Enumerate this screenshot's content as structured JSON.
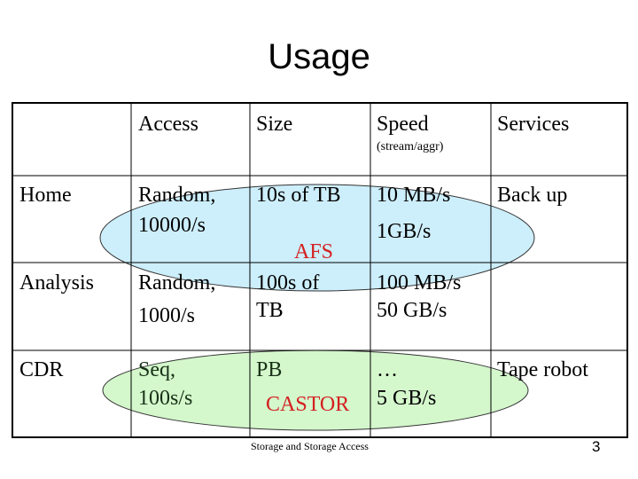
{
  "title": "Usage",
  "table": {
    "headers": [
      "",
      "Access",
      "Size",
      "Speed",
      "Services"
    ],
    "speed_subheader": "(stream/aggr)",
    "rows": [
      {
        "name": "Home",
        "access": [
          "Random,",
          "10000/s"
        ],
        "size": [
          "10s of TB"
        ],
        "speed": [
          "10 MB/s",
          "1GB/s"
        ],
        "services": "Back up"
      },
      {
        "name": "Analysis",
        "access": [
          "Random,",
          "1000/s"
        ],
        "size": [
          "100s of",
          "TB"
        ],
        "speed": [
          "100 MB/s",
          "50 GB/s"
        ],
        "services": ""
      },
      {
        "name": "CDR",
        "access": [
          "Seq,",
          "100s/s"
        ],
        "size": [
          "PB"
        ],
        "speed": [
          "…",
          "5 GB/s"
        ],
        "services": "Tape robot"
      }
    ]
  },
  "groups": [
    {
      "label": "AFS",
      "color": "#cdeefb"
    },
    {
      "label": "CASTOR",
      "color": "#d4f7cc"
    }
  ],
  "label_color": "#d42020",
  "footer": "Storage and Storage Access",
  "page_number": "3"
}
